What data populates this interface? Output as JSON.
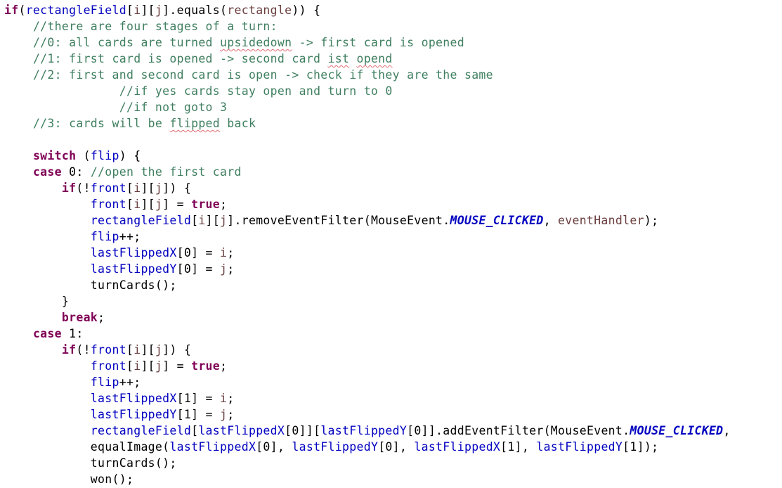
{
  "editor": {
    "language": "java",
    "colors": {
      "keyword": "#7f0055",
      "field": "#0000c0",
      "local_variable": "#6a3e3e",
      "comment": "#3f7f5f",
      "static_constant": "#0000c0",
      "spell_check_underline": "#e06c75"
    },
    "lines": [
      [
        {
          "t": "if",
          "c": "kw"
        },
        {
          "t": "("
        },
        {
          "t": "rectangleField",
          "c": "var"
        },
        {
          "t": "["
        },
        {
          "t": "i",
          "c": "param"
        },
        {
          "t": "]["
        },
        {
          "t": "j",
          "c": "param"
        },
        {
          "t": "].equals("
        },
        {
          "t": "rectangle",
          "c": "param"
        },
        {
          "t": ")) {"
        }
      ],
      [
        {
          "t": "    "
        },
        {
          "t": "//there are four stages of a turn:",
          "c": "cm"
        }
      ],
      [
        {
          "t": "    "
        },
        {
          "t": "//0: all cards are turned ",
          "c": "cm"
        },
        {
          "t": "upsidedown",
          "c": "cm",
          "spell": true
        },
        {
          "t": " -> first card is opened",
          "c": "cm"
        }
      ],
      [
        {
          "t": "    "
        },
        {
          "t": "//1: first card is opened -> second card ",
          "c": "cm"
        },
        {
          "t": "ist",
          "c": "cm",
          "spell": true
        },
        {
          "t": " ",
          "c": "cm"
        },
        {
          "t": "opend",
          "c": "cm",
          "spell": true
        }
      ],
      [
        {
          "t": "    "
        },
        {
          "t": "//2: first and second card is open -> check if they are the same",
          "c": "cm"
        }
      ],
      [
        {
          "t": "                "
        },
        {
          "t": "//if yes cards stay open and turn to 0",
          "c": "cm"
        }
      ],
      [
        {
          "t": "                "
        },
        {
          "t": "//if not goto 3",
          "c": "cm"
        }
      ],
      [
        {
          "t": "    "
        },
        {
          "t": "//3: cards will be ",
          "c": "cm"
        },
        {
          "t": "flipped",
          "c": "cm",
          "spell": true
        },
        {
          "t": " back",
          "c": "cm"
        }
      ],
      [],
      [
        {
          "t": "    "
        },
        {
          "t": "switch",
          "c": "kw"
        },
        {
          "t": " ("
        },
        {
          "t": "flip",
          "c": "var"
        },
        {
          "t": ") {"
        }
      ],
      [
        {
          "t": "    "
        },
        {
          "t": "case",
          "c": "kw"
        },
        {
          "t": " 0: "
        },
        {
          "t": "//open the first card",
          "c": "cm"
        }
      ],
      [
        {
          "t": "        "
        },
        {
          "t": "if",
          "c": "kw"
        },
        {
          "t": "(!"
        },
        {
          "t": "front",
          "c": "var"
        },
        {
          "t": "["
        },
        {
          "t": "i",
          "c": "param"
        },
        {
          "t": "]["
        },
        {
          "t": "j",
          "c": "param"
        },
        {
          "t": "]) {"
        }
      ],
      [
        {
          "t": "            "
        },
        {
          "t": "front",
          "c": "var"
        },
        {
          "t": "["
        },
        {
          "t": "i",
          "c": "param"
        },
        {
          "t": "]["
        },
        {
          "t": "j",
          "c": "param"
        },
        {
          "t": "] = "
        },
        {
          "t": "true",
          "c": "kw"
        },
        {
          "t": ";"
        }
      ],
      [
        {
          "t": "            "
        },
        {
          "t": "rectangleField",
          "c": "var"
        },
        {
          "t": "["
        },
        {
          "t": "i",
          "c": "param"
        },
        {
          "t": "]["
        },
        {
          "t": "j",
          "c": "param"
        },
        {
          "t": "].removeEventFilter(MouseEvent."
        },
        {
          "t": "MOUSE_CLICKED",
          "c": "const"
        },
        {
          "t": ", "
        },
        {
          "t": "eventHandler",
          "c": "param"
        },
        {
          "t": ");"
        }
      ],
      [
        {
          "t": "            "
        },
        {
          "t": "flip",
          "c": "var"
        },
        {
          "t": "++;"
        }
      ],
      [
        {
          "t": "            "
        },
        {
          "t": "lastFlippedX",
          "c": "var"
        },
        {
          "t": "[0] = "
        },
        {
          "t": "i",
          "c": "param"
        },
        {
          "t": ";"
        }
      ],
      [
        {
          "t": "            "
        },
        {
          "t": "lastFlippedY",
          "c": "var"
        },
        {
          "t": "[0] = "
        },
        {
          "t": "j",
          "c": "param"
        },
        {
          "t": ";"
        }
      ],
      [
        {
          "t": "            turnCards();"
        }
      ],
      [
        {
          "t": "        }"
        }
      ],
      [
        {
          "t": "        "
        },
        {
          "t": "break",
          "c": "kw"
        },
        {
          "t": ";"
        }
      ],
      [
        {
          "t": "    "
        },
        {
          "t": "case",
          "c": "kw"
        },
        {
          "t": " 1:"
        }
      ],
      [
        {
          "t": "        "
        },
        {
          "t": "if",
          "c": "kw"
        },
        {
          "t": "(!"
        },
        {
          "t": "front",
          "c": "var"
        },
        {
          "t": "["
        },
        {
          "t": "i",
          "c": "param"
        },
        {
          "t": "]["
        },
        {
          "t": "j",
          "c": "param"
        },
        {
          "t": "]) {"
        }
      ],
      [
        {
          "t": "            "
        },
        {
          "t": "front",
          "c": "var"
        },
        {
          "t": "["
        },
        {
          "t": "i",
          "c": "param"
        },
        {
          "t": "]["
        },
        {
          "t": "j",
          "c": "param"
        },
        {
          "t": "] = "
        },
        {
          "t": "true",
          "c": "kw"
        },
        {
          "t": ";"
        }
      ],
      [
        {
          "t": "            "
        },
        {
          "t": "flip",
          "c": "var"
        },
        {
          "t": "++;"
        }
      ],
      [
        {
          "t": "            "
        },
        {
          "t": "lastFlippedX",
          "c": "var"
        },
        {
          "t": "[1] = "
        },
        {
          "t": "i",
          "c": "param"
        },
        {
          "t": ";"
        }
      ],
      [
        {
          "t": "            "
        },
        {
          "t": "lastFlippedY",
          "c": "var"
        },
        {
          "t": "[1] = "
        },
        {
          "t": "j",
          "c": "param"
        },
        {
          "t": ";"
        }
      ],
      [
        {
          "t": "            "
        },
        {
          "t": "rectangleField",
          "c": "var"
        },
        {
          "t": "["
        },
        {
          "t": "lastFlippedX",
          "c": "var"
        },
        {
          "t": "[0]]["
        },
        {
          "t": "lastFlippedY",
          "c": "var"
        },
        {
          "t": "[0]].addEventFilter(MouseEvent."
        },
        {
          "t": "MOUSE_CLICKED",
          "c": "const"
        },
        {
          "t": ","
        }
      ],
      [
        {
          "t": "            equalImage("
        },
        {
          "t": "lastFlippedX",
          "c": "var"
        },
        {
          "t": "[0], "
        },
        {
          "t": "lastFlippedY",
          "c": "var"
        },
        {
          "t": "[0], "
        },
        {
          "t": "lastFlippedX",
          "c": "var"
        },
        {
          "t": "[1], "
        },
        {
          "t": "lastFlippedY",
          "c": "var"
        },
        {
          "t": "[1]);"
        }
      ],
      [
        {
          "t": "            turnCards();"
        }
      ],
      [
        {
          "t": "            won();"
        }
      ]
    ]
  }
}
